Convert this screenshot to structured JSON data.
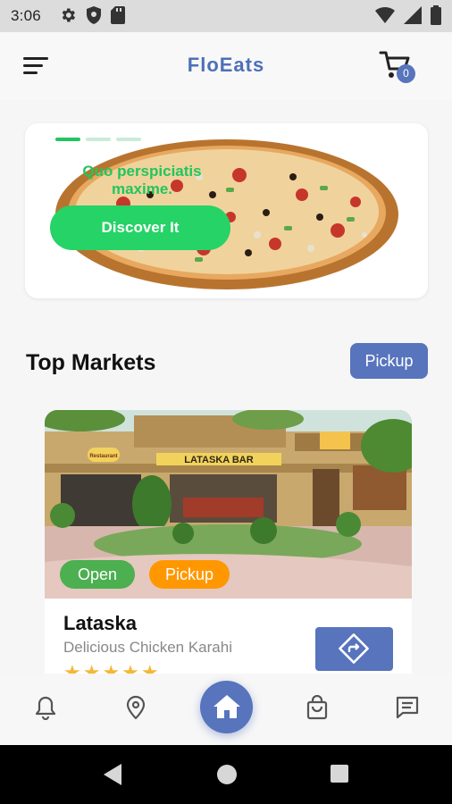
{
  "status_bar": {
    "time": "3:06",
    "left_icons": [
      "gear-icon",
      "shield-icon",
      "sd-card-icon"
    ],
    "right_icons": [
      "wifi-icon",
      "signal-icon",
      "battery-icon"
    ]
  },
  "app_bar": {
    "title": "FloEats",
    "cart_count": "0"
  },
  "banner": {
    "text": "Quo perspiciatis maxime.",
    "button_label": "Discover It",
    "slides": 3,
    "active_slide": 0
  },
  "section": {
    "title": "Top Markets",
    "pickup_label": "Pickup"
  },
  "market": {
    "name": "Lataska",
    "description": "Delicious Chicken Karahi",
    "tags": [
      "Open",
      "Pickup"
    ],
    "rating": 5,
    "stars": "★★★★★",
    "image_signs": [
      "LATASKA BAR",
      "Restaurant"
    ]
  },
  "bottom_nav": {
    "items": [
      "bell-icon",
      "location-icon",
      "home-icon",
      "shopping-bag-icon",
      "chat-icon"
    ],
    "active": "home-icon"
  },
  "colors": {
    "primary": "#5774bd",
    "accent_green": "#25d366",
    "open_green": "#4caf50",
    "pickup_orange": "#ff9800",
    "star": "#f5b836"
  }
}
